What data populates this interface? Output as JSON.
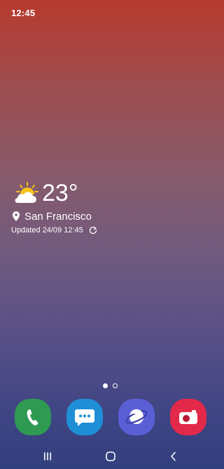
{
  "status_bar": {
    "time": "12:45"
  },
  "weather": {
    "temperature": "23°",
    "condition_icon": "partly-sunny-icon",
    "location_icon": "location-pin-icon",
    "location": "San Francisco",
    "updated": "Updated 24/09 12:45",
    "refresh_icon": "refresh-icon"
  },
  "home": {
    "pages": 2,
    "current_page": 1
  },
  "dock": {
    "apps": [
      {
        "name": "Phone",
        "icon": "phone-icon",
        "color": "#2e9a52"
      },
      {
        "name": "Messages",
        "icon": "messages-icon",
        "color": "#1e8fd6"
      },
      {
        "name": "Internet",
        "icon": "internet-planet-icon",
        "color": "#5b5fd6"
      },
      {
        "name": "Camera",
        "icon": "camera-icon",
        "color": "#e3294a"
      }
    ]
  },
  "navigation": {
    "recents_icon": "recents-icon",
    "home_icon": "home-icon",
    "back_icon": "back-icon"
  }
}
